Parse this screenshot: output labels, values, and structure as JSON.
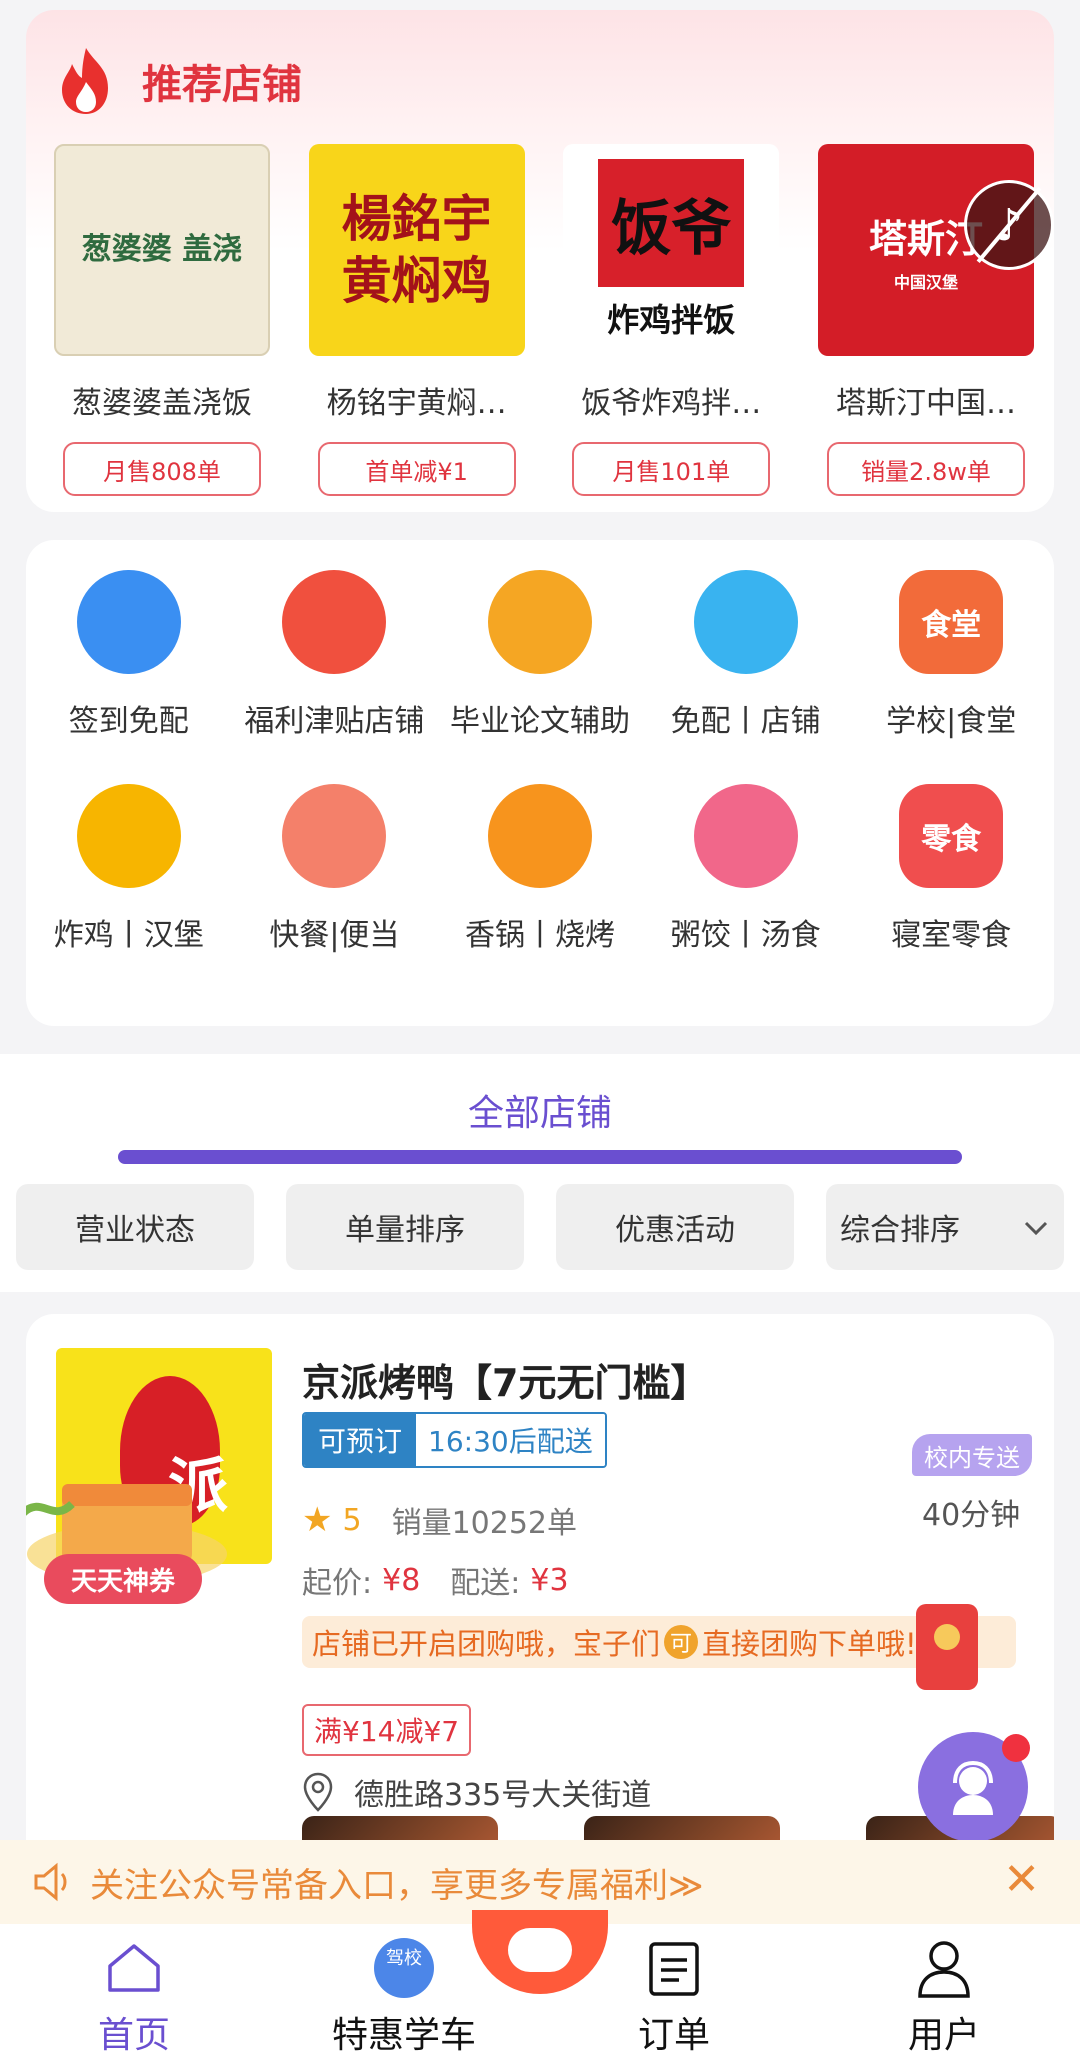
{
  "recommended": {
    "title": "推荐店铺",
    "shops": [
      {
        "name": "葱婆婆盖浇饭",
        "tag": "月售808单",
        "logo_text": "葱婆婆 盖浇"
      },
      {
        "name": "杨铭宇黄焖…",
        "tag": "首单减¥1",
        "logo_text": "楊銘宇 黄焖鸡"
      },
      {
        "name": "饭爷炸鸡拌…",
        "tag": "月售101单",
        "logo_text": "饭爷",
        "logo_sub": "炸鸡拌饭"
      },
      {
        "name": "塔斯汀中国…",
        "tag": "销量2.8w单",
        "logo_text": "塔斯汀",
        "logo_sub": "中国汉堡"
      }
    ]
  },
  "categories": [
    {
      "label": "签到免配",
      "icon": "blue-circles-icon",
      "color": "#3a8ff2"
    },
    {
      "label": "福利津贴店铺",
      "icon": "spoon-fork-icon",
      "color": "#f0503e"
    },
    {
      "label": "毕业论文辅助",
      "icon": "bee-mascot-icon",
      "color": "#f5a623"
    },
    {
      "label": "免配丨店铺",
      "icon": "basket-icon",
      "color": "#39b3f0"
    },
    {
      "label": "学校|食堂",
      "icon": "canteen-icon",
      "color": "#f26b3a",
      "icon_text": "食堂"
    },
    {
      "label": "炸鸡丨汉堡",
      "icon": "burger-icon",
      "color": "#f7b500"
    },
    {
      "label": "快餐|便当",
      "icon": "cloche-icon",
      "color": "#f4806a"
    },
    {
      "label": "香锅丨烧烤",
      "icon": "skewer-icon",
      "color": "#f7941d"
    },
    {
      "label": "粥饺丨汤食",
      "icon": "noodle-bowl-icon",
      "color": "#f1678a"
    },
    {
      "label": "寝室零食",
      "icon": "snack-icon",
      "color": "#f04e4e",
      "icon_text": "零食"
    }
  ],
  "tabs": {
    "all_shops": "全部店铺"
  },
  "filters": {
    "status": "营业状态",
    "order_count": "单量排序",
    "promotion": "优惠活动",
    "sort": "综合排序"
  },
  "listing": {
    "name": "京派烤鸭【7元无门槛】",
    "logo_text": "派",
    "coupon_badge": "天天神券",
    "preorder_label": "可预订",
    "preorder_time": "16:30后配送",
    "campus_tag": "校内专送",
    "delivery_time": "40分钟",
    "rating": "5",
    "sales": "销量10252单",
    "min_price_label": "起价:",
    "min_price": "¥8",
    "delivery_fee_label": "配送:",
    "delivery_fee": "¥3",
    "group_text_1": "店铺已开启团购哦，宝子们",
    "group_badge": "可",
    "group_text_2": "直接团购下单哦!",
    "promo": "满¥14减¥7",
    "address": "德胜路335号大关街道"
  },
  "notice": {
    "text": "关注公众号常备入口，享更多专属福利≫"
  },
  "nav": {
    "home": "首页",
    "driving": "特惠学车",
    "driving_icon_text": "驾校",
    "orders": "订单",
    "user": "用户"
  }
}
